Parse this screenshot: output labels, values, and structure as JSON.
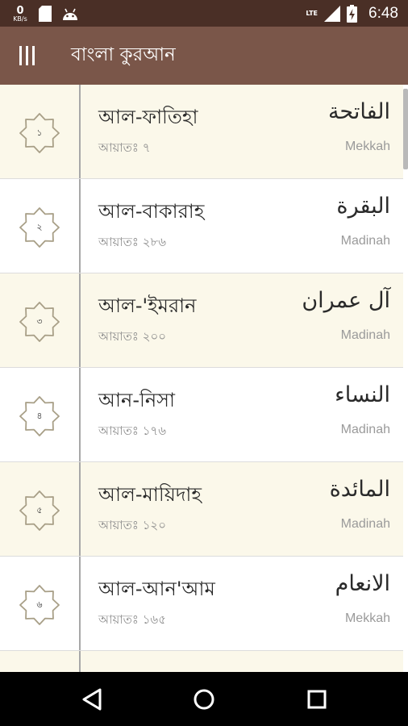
{
  "status_bar": {
    "speed_value": "0",
    "speed_unit": "KB/s",
    "network_label": "LTE",
    "time": "6:48"
  },
  "app_bar": {
    "title": "বাংলা কুরআন",
    "menu_icon": "menu-icon"
  },
  "surahs": [
    {
      "number": "১",
      "bangla_name": "আল-ফাতিহা",
      "ayat": "আয়াতঃ ৭",
      "arabic_name": "الفاتحة",
      "revelation_place": "Mekkah"
    },
    {
      "number": "২",
      "bangla_name": "আল-বাকারাহ",
      "ayat": "আয়াতঃ ২৮৬",
      "arabic_name": "البقرة",
      "revelation_place": "Madinah"
    },
    {
      "number": "৩",
      "bangla_name": "আল-'ইমরান",
      "ayat": "আয়াতঃ ২০০",
      "arabic_name": "آل عمران",
      "revelation_place": "Madinah"
    },
    {
      "number": "৪",
      "bangla_name": "আন-নিসা",
      "ayat": "আয়াতঃ ১৭৬",
      "arabic_name": "النساء",
      "revelation_place": "Madinah"
    },
    {
      "number": "৫",
      "bangla_name": "আল-মায়িদাহ",
      "ayat": "আয়াতঃ ১২০",
      "arabic_name": "المائدة",
      "revelation_place": "Madinah"
    },
    {
      "number": "৬",
      "bangla_name": "আল-আন'আম",
      "ayat": "আয়াতঃ ১৬৫",
      "arabic_name": "الانعام",
      "revelation_place": "Mekkah"
    }
  ],
  "colors": {
    "status_bar": "#4a2f26",
    "app_bar": "#7a5649",
    "row_shaded": "#fbf8ea",
    "row_plain": "#ffffff",
    "badge_outline": "#a89f87",
    "nav_bar": "#000000"
  },
  "nav_bar": {
    "back_icon": "back-triangle-icon",
    "home_icon": "home-circle-icon",
    "recents_icon": "recents-square-icon"
  }
}
